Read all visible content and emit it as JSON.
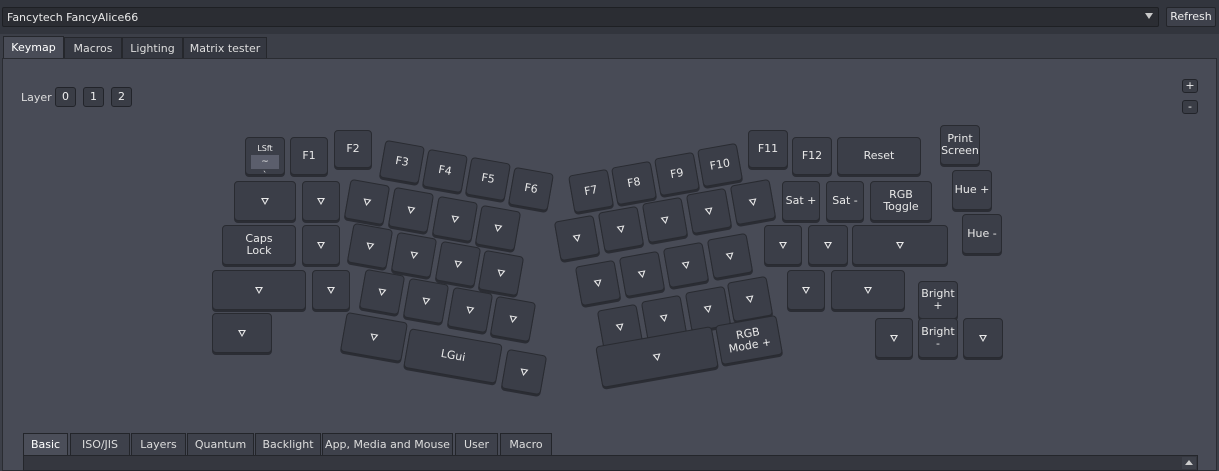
{
  "keyboard_select": {
    "value": "Fancytech FancyAlice66"
  },
  "refresh_label": "Refresh",
  "tabs": [
    "Keymap",
    "Macros",
    "Lighting",
    "Matrix tester"
  ],
  "layer": {
    "label": "Layer",
    "buttons": [
      "0",
      "1",
      "2"
    ]
  },
  "zoom": {
    "plus": "+",
    "minus": "-"
  },
  "keys": {
    "lsft_top": "LSft",
    "lsft_bottom": "~\n`",
    "f1": "F1",
    "f2": "F2",
    "f3": "F3",
    "f4": "F4",
    "f5": "F5",
    "f6": "F6",
    "f7": "F7",
    "f8": "F8",
    "f9": "F9",
    "f10": "F10",
    "f11": "F11",
    "f12": "F12",
    "reset": "Reset",
    "print_screen": "Print\nScreen",
    "caps_lock": "Caps\nLock",
    "lgui": "LGui",
    "sat_plus": "Sat +",
    "sat_minus": "Sat -",
    "rgb_toggle": "RGB\nToggle",
    "hue_plus": "Hue +",
    "hue_minus": "Hue -",
    "bright_plus": "Bright +",
    "bright_minus": "Bright -",
    "rgb_mode_plus": "RGB\nMode +"
  },
  "bottom_tabs": [
    "Basic",
    "ISO/JIS",
    "Layers",
    "Quantum",
    "Backlight",
    "App, Media and Mouse",
    "User",
    "Macro"
  ]
}
